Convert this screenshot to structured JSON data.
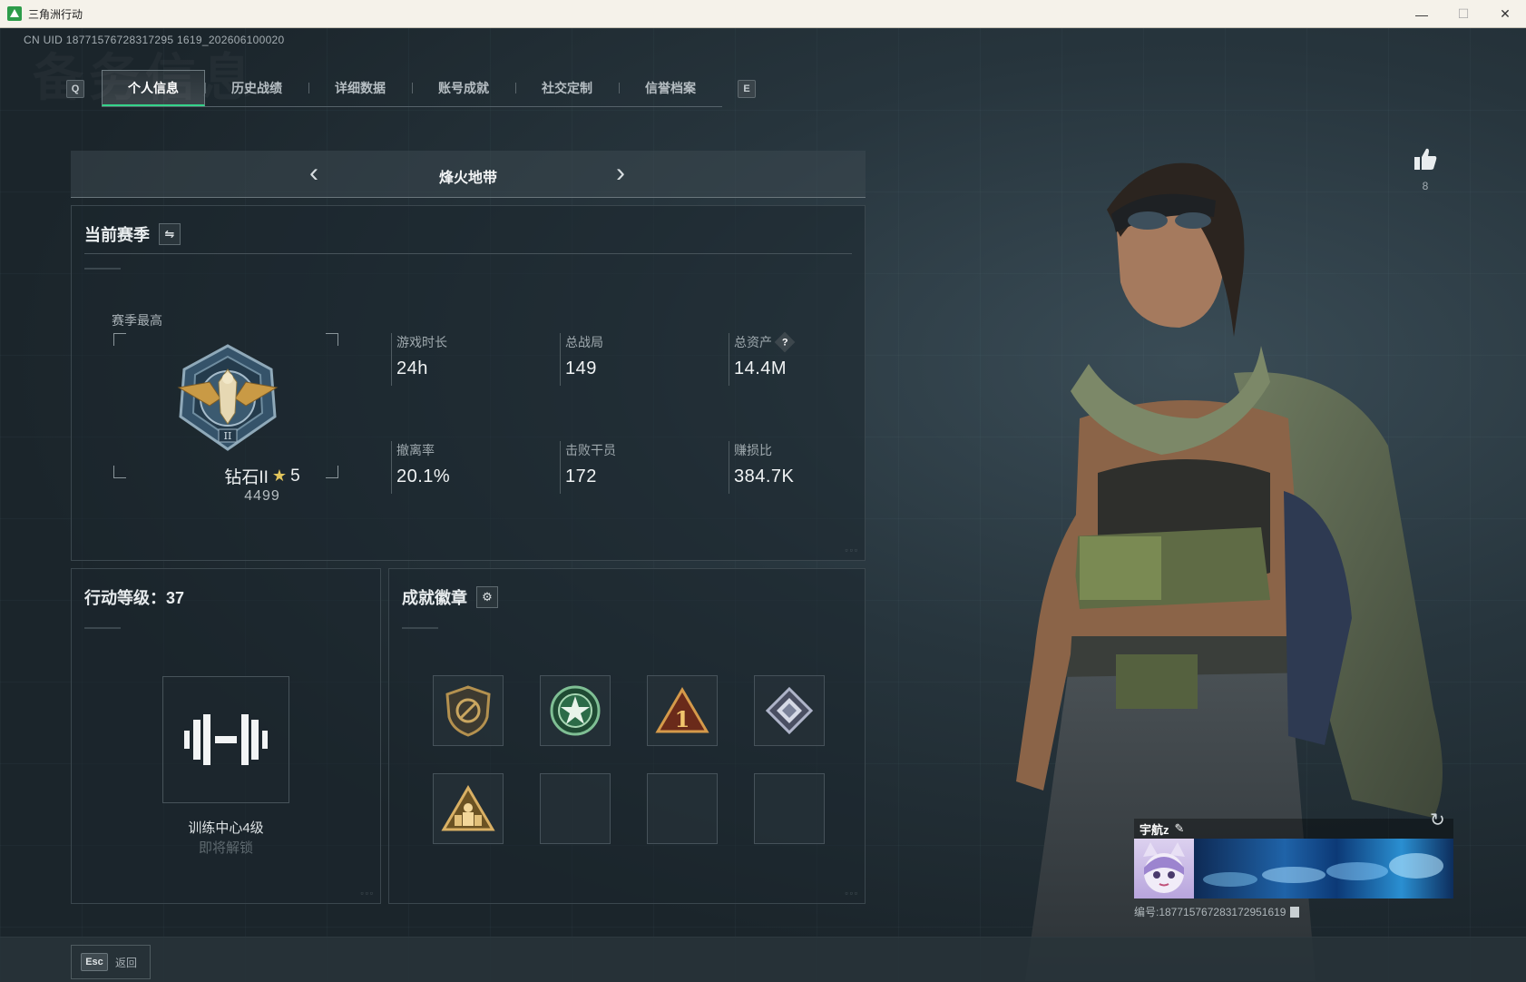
{
  "window": {
    "title": "三角洲行动",
    "controls": [
      "—",
      "☐",
      "✕"
    ]
  },
  "uid_text": "CN UID 18771576728317295 1619_202606100020",
  "watermark": "备务信息",
  "tab_keys": {
    "left": "Q",
    "right": "E"
  },
  "tabs": [
    {
      "label": "个人信息",
      "active": true
    },
    {
      "label": "历史战绩",
      "active": false
    },
    {
      "label": "详细数据",
      "active": false
    },
    {
      "label": "账号成就",
      "active": false
    },
    {
      "label": "社交定制",
      "active": false
    },
    {
      "label": "信誉档案",
      "active": false
    }
  ],
  "mode": {
    "title": "烽火地带",
    "prev_icon": "chevron-left-icon",
    "next_icon": "chevron-right-icon"
  },
  "season": {
    "title": "当前赛季",
    "switch_icon": "swap-icon",
    "best_label": "赛季最高",
    "rank_name": "钻石II",
    "rank_stars": "5",
    "rank_score": "4499",
    "stats": [
      {
        "label": "游戏时长",
        "value": "24h"
      },
      {
        "label": "总战局",
        "value": "149"
      },
      {
        "label": "总资产",
        "value": "14.4M",
        "help": true
      },
      {
        "label": "撤离率",
        "value": "20.1%"
      },
      {
        "label": "击败干员",
        "value": "172"
      },
      {
        "label": "赚损比",
        "value": "384.7K"
      }
    ]
  },
  "level": {
    "title": "行动等级：37",
    "facility_name": "训练中心4级",
    "facility_status": "即将解锁",
    "facility_icon": "dumbbell-icon"
  },
  "achievements": {
    "title": "成就徽章",
    "settings_icon": "gear-icon",
    "badges": [
      {
        "icon": "shield-badge-icon",
        "filled": true
      },
      {
        "icon": "star-wreath-badge-icon",
        "filled": true
      },
      {
        "icon": "triangle-one-badge-icon",
        "filled": true
      },
      {
        "icon": "crystal-badge-icon",
        "filled": true
      },
      {
        "icon": "soldier-triangle-badge-icon",
        "filled": true
      },
      {
        "icon": "empty-slot",
        "filled": false
      },
      {
        "icon": "empty-slot",
        "filled": false
      },
      {
        "icon": "empty-slot",
        "filled": false
      }
    ]
  },
  "likes": {
    "icon": "thumbs-up-icon",
    "count": "8"
  },
  "player_card": {
    "name": "宇航z",
    "edit_icon": "pencil-icon",
    "id_text": "编号:187715767283172951619",
    "copy_icon": "copy-icon"
  },
  "footer": {
    "key": "Esc",
    "label": "返回"
  },
  "colors": {
    "accent": "#35d38a",
    "gold": "#e2c55c"
  }
}
